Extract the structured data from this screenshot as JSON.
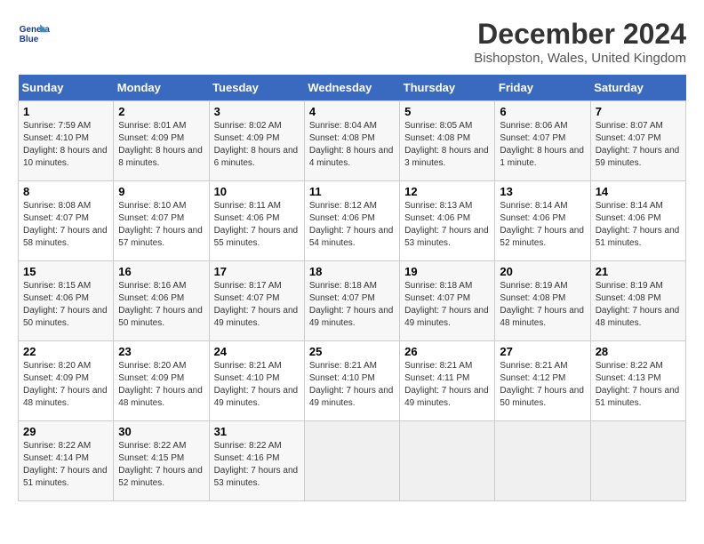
{
  "header": {
    "title": "December 2024",
    "subtitle": "Bishopston, Wales, United Kingdom",
    "logo_line1": "General",
    "logo_line2": "Blue"
  },
  "days_of_week": [
    "Sunday",
    "Monday",
    "Tuesday",
    "Wednesday",
    "Thursday",
    "Friday",
    "Saturday"
  ],
  "weeks": [
    [
      {
        "day": "1",
        "sunrise": "Sunrise: 7:59 AM",
        "sunset": "Sunset: 4:10 PM",
        "daylight": "Daylight: 8 hours and 10 minutes."
      },
      {
        "day": "2",
        "sunrise": "Sunrise: 8:01 AM",
        "sunset": "Sunset: 4:09 PM",
        "daylight": "Daylight: 8 hours and 8 minutes."
      },
      {
        "day": "3",
        "sunrise": "Sunrise: 8:02 AM",
        "sunset": "Sunset: 4:09 PM",
        "daylight": "Daylight: 8 hours and 6 minutes."
      },
      {
        "day": "4",
        "sunrise": "Sunrise: 8:04 AM",
        "sunset": "Sunset: 4:08 PM",
        "daylight": "Daylight: 8 hours and 4 minutes."
      },
      {
        "day": "5",
        "sunrise": "Sunrise: 8:05 AM",
        "sunset": "Sunset: 4:08 PM",
        "daylight": "Daylight: 8 hours and 3 minutes."
      },
      {
        "day": "6",
        "sunrise": "Sunrise: 8:06 AM",
        "sunset": "Sunset: 4:07 PM",
        "daylight": "Daylight: 8 hours and 1 minute."
      },
      {
        "day": "7",
        "sunrise": "Sunrise: 8:07 AM",
        "sunset": "Sunset: 4:07 PM",
        "daylight": "Daylight: 7 hours and 59 minutes."
      }
    ],
    [
      {
        "day": "8",
        "sunrise": "Sunrise: 8:08 AM",
        "sunset": "Sunset: 4:07 PM",
        "daylight": "Daylight: 7 hours and 58 minutes."
      },
      {
        "day": "9",
        "sunrise": "Sunrise: 8:10 AM",
        "sunset": "Sunset: 4:07 PM",
        "daylight": "Daylight: 7 hours and 57 minutes."
      },
      {
        "day": "10",
        "sunrise": "Sunrise: 8:11 AM",
        "sunset": "Sunset: 4:06 PM",
        "daylight": "Daylight: 7 hours and 55 minutes."
      },
      {
        "day": "11",
        "sunrise": "Sunrise: 8:12 AM",
        "sunset": "Sunset: 4:06 PM",
        "daylight": "Daylight: 7 hours and 54 minutes."
      },
      {
        "day": "12",
        "sunrise": "Sunrise: 8:13 AM",
        "sunset": "Sunset: 4:06 PM",
        "daylight": "Daylight: 7 hours and 53 minutes."
      },
      {
        "day": "13",
        "sunrise": "Sunrise: 8:14 AM",
        "sunset": "Sunset: 4:06 PM",
        "daylight": "Daylight: 7 hours and 52 minutes."
      },
      {
        "day": "14",
        "sunrise": "Sunrise: 8:14 AM",
        "sunset": "Sunset: 4:06 PM",
        "daylight": "Daylight: 7 hours and 51 minutes."
      }
    ],
    [
      {
        "day": "15",
        "sunrise": "Sunrise: 8:15 AM",
        "sunset": "Sunset: 4:06 PM",
        "daylight": "Daylight: 7 hours and 50 minutes."
      },
      {
        "day": "16",
        "sunrise": "Sunrise: 8:16 AM",
        "sunset": "Sunset: 4:06 PM",
        "daylight": "Daylight: 7 hours and 50 minutes."
      },
      {
        "day": "17",
        "sunrise": "Sunrise: 8:17 AM",
        "sunset": "Sunset: 4:07 PM",
        "daylight": "Daylight: 7 hours and 49 minutes."
      },
      {
        "day": "18",
        "sunrise": "Sunrise: 8:18 AM",
        "sunset": "Sunset: 4:07 PM",
        "daylight": "Daylight: 7 hours and 49 minutes."
      },
      {
        "day": "19",
        "sunrise": "Sunrise: 8:18 AM",
        "sunset": "Sunset: 4:07 PM",
        "daylight": "Daylight: 7 hours and 49 minutes."
      },
      {
        "day": "20",
        "sunrise": "Sunrise: 8:19 AM",
        "sunset": "Sunset: 4:08 PM",
        "daylight": "Daylight: 7 hours and 48 minutes."
      },
      {
        "day": "21",
        "sunrise": "Sunrise: 8:19 AM",
        "sunset": "Sunset: 4:08 PM",
        "daylight": "Daylight: 7 hours and 48 minutes."
      }
    ],
    [
      {
        "day": "22",
        "sunrise": "Sunrise: 8:20 AM",
        "sunset": "Sunset: 4:09 PM",
        "daylight": "Daylight: 7 hours and 48 minutes."
      },
      {
        "day": "23",
        "sunrise": "Sunrise: 8:20 AM",
        "sunset": "Sunset: 4:09 PM",
        "daylight": "Daylight: 7 hours and 48 minutes."
      },
      {
        "day": "24",
        "sunrise": "Sunrise: 8:21 AM",
        "sunset": "Sunset: 4:10 PM",
        "daylight": "Daylight: 7 hours and 49 minutes."
      },
      {
        "day": "25",
        "sunrise": "Sunrise: 8:21 AM",
        "sunset": "Sunset: 4:10 PM",
        "daylight": "Daylight: 7 hours and 49 minutes."
      },
      {
        "day": "26",
        "sunrise": "Sunrise: 8:21 AM",
        "sunset": "Sunset: 4:11 PM",
        "daylight": "Daylight: 7 hours and 49 minutes."
      },
      {
        "day": "27",
        "sunrise": "Sunrise: 8:21 AM",
        "sunset": "Sunset: 4:12 PM",
        "daylight": "Daylight: 7 hours and 50 minutes."
      },
      {
        "day": "28",
        "sunrise": "Sunrise: 8:22 AM",
        "sunset": "Sunset: 4:13 PM",
        "daylight": "Daylight: 7 hours and 51 minutes."
      }
    ],
    [
      {
        "day": "29",
        "sunrise": "Sunrise: 8:22 AM",
        "sunset": "Sunset: 4:14 PM",
        "daylight": "Daylight: 7 hours and 51 minutes."
      },
      {
        "day": "30",
        "sunrise": "Sunrise: 8:22 AM",
        "sunset": "Sunset: 4:15 PM",
        "daylight": "Daylight: 7 hours and 52 minutes."
      },
      {
        "day": "31",
        "sunrise": "Sunrise: 8:22 AM",
        "sunset": "Sunset: 4:16 PM",
        "daylight": "Daylight: 7 hours and 53 minutes."
      },
      null,
      null,
      null,
      null
    ]
  ]
}
